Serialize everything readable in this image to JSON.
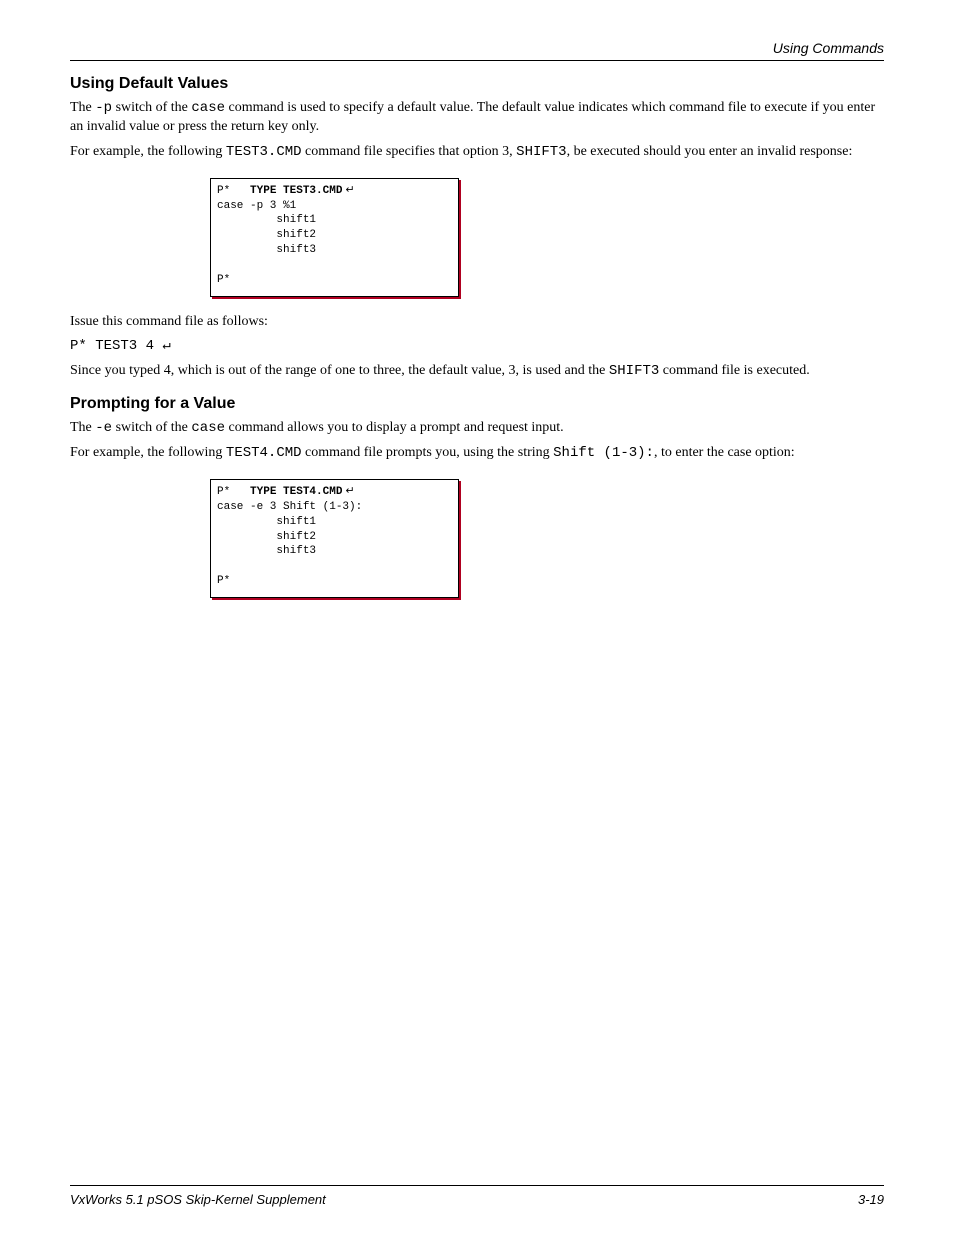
{
  "header": {
    "right": "Using Commands"
  },
  "s1": {
    "title": "Using Default Values",
    "p1_a": "The ",
    "p1_b": " switch of the ",
    "p1_c": " command is used to specify a default value. The default value indicates which command file to execute if you enter an invalid value or press the return key only.",
    "p2_a": "For example, the following ",
    "p2_b": " command file specifies that option 3, ",
    "p2_c": ", be executed should you enter an invalid response:",
    "sw_p": "-p",
    "cmd_case": "case",
    "file3": "TEST3.CMD",
    "file3_mono": "SHIFT3",
    "p3": "Issue this command file as follows:",
    "cmd_line": "P* TEST3 4 ↵",
    "p4_a": "Since you typed 4, which is out of the range of one to three, the default value, 3, is used and the ",
    "p4_b": " command file is executed.",
    "shift3": "SHIFT3"
  },
  "code1": {
    "prompt1a": "P*   ",
    "cmd1": "TYPE TEST3.CMD",
    "ret": " ↵",
    "l1": "case -p 3 %1",
    "l2": "         shift1",
    "l3": "         shift2",
    "l4": "         shift3",
    "blank": " ",
    "prompt2": "P*"
  },
  "s2": {
    "title": "Prompting for a Value",
    "p1_a": "The ",
    "p1_b": " switch of the ",
    "p1_c": " command allows you to display a prompt and request input.",
    "sw_e": "-e",
    "cmd_case": "case",
    "p2_a": "For example, the following ",
    "p2_b": " command file prompts you, using the string ",
    "p2_c": ", to enter the case option:",
    "file4": "TEST4.CMD",
    "prompt_str": "Shift (1-3):"
  },
  "code2": {
    "prompt1a": "P*   ",
    "cmd1": "TYPE TEST4.CMD",
    "ret": " ↵",
    "l1": "case -e 3 Shift (1-3):",
    "l2": "         shift1",
    "l3": "         shift2",
    "l4": "         shift3",
    "blank": " ",
    "prompt2": "P*"
  },
  "footer": {
    "left": "VxWorks 5.1 pSOS Skip-Kernel Supplement",
    "right": "3-19"
  }
}
